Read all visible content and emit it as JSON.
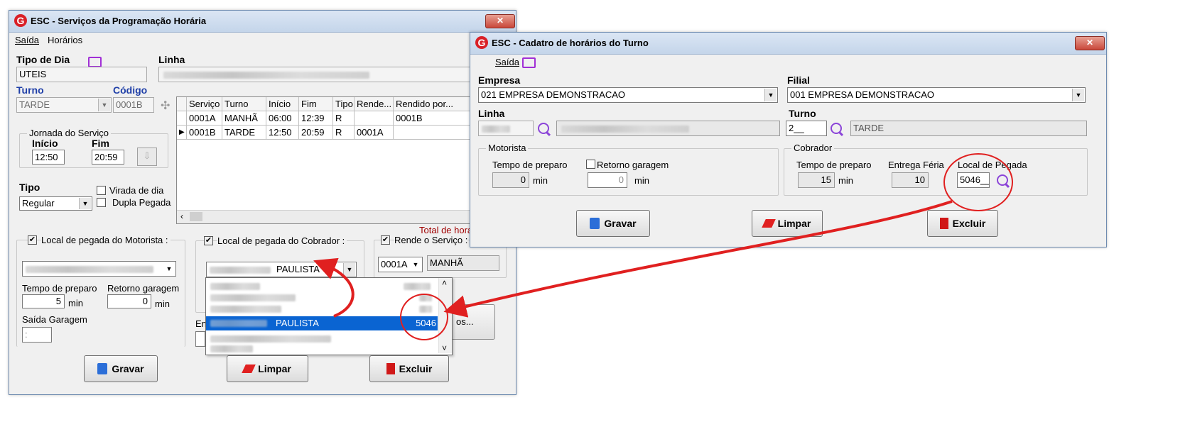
{
  "win1": {
    "title": "ESC - Serviços da Programação Horária",
    "menu": [
      "Saída",
      "Horários"
    ],
    "tipo_de_dia": {
      "label": "Tipo de Dia",
      "value": "UTEIS"
    },
    "linha": {
      "label": "Linha"
    },
    "turno": {
      "label": "Turno",
      "value": "TARDE"
    },
    "codigo": {
      "label": "Código",
      "value": "0001B"
    },
    "jornada": {
      "label": "Jornada do Serviço",
      "inicio_label": "Início",
      "inicio": "12:50",
      "fim_label": "Fim",
      "fim": "20:59"
    },
    "tipo": {
      "label": "Tipo",
      "value": "Regular"
    },
    "virada": "Virada de dia",
    "dupla": "Dupla Pegada",
    "grid": {
      "columns": [
        "Serviço",
        "Turno",
        "Início",
        "Fim",
        "Tipo",
        "Rende...",
        "Rendido por..."
      ],
      "rows": [
        [
          "0001A",
          "MANHÃ",
          "06:00",
          "12:39",
          "R",
          "",
          "0001B"
        ],
        [
          "0001B",
          "TARDE",
          "12:50",
          "20:59",
          "R",
          "0001A",
          ""
        ]
      ]
    },
    "total_label": "Total de hora",
    "motorista_group": "Local de pegada do Motorista :",
    "tempo_preparo_label": "Tempo de preparo",
    "tempo_preparo": "5",
    "retorno_label": "Retorno garagem",
    "retorno": "0",
    "min": "min",
    "saida_garagem_label": "Saída Garagem",
    "saida_garagem": ":",
    "cobrador_group": "Local de pegada do Cobrador :",
    "cobrador_value": "PAULISTA",
    "dropdown_selected": {
      "name": "PAULISTA",
      "code": "5046"
    },
    "rende_group": "Rende o Serviço :",
    "rende_code": "0001A",
    "rende_turno": "MANHÃ",
    "en_label": "En",
    "partial_button": "os...",
    "buttons": {
      "gravar": "Gravar",
      "limpar": "Limpar",
      "excluir": "Excluir"
    }
  },
  "win2": {
    "title": "ESC - Cadatro de horários do Turno",
    "menu": [
      "Saída"
    ],
    "empresa": {
      "label": "Empresa",
      "value": "021 EMPRESA DEMONSTRACAO"
    },
    "filial": {
      "label": "Filial",
      "value": "001 EMPRESA DEMONSTRACAO"
    },
    "linha": {
      "label": "Linha"
    },
    "turno": {
      "label": "Turno",
      "code": "2__",
      "value": "TARDE"
    },
    "motorista": {
      "group": "Motorista",
      "tempo_label": "Tempo de preparo",
      "tempo": "0",
      "retorno_label": "Retorno garagem",
      "retorno": "0"
    },
    "cobrador": {
      "group": "Cobrador",
      "tempo_label": "Tempo de preparo",
      "tempo": "15",
      "entrega_label": "Entrega Féria",
      "entrega": "10",
      "local_label": "Local de Pegada",
      "local": "5046__"
    },
    "min": "min",
    "buttons": {
      "gravar": "Gravar",
      "limpar": "Limpar",
      "excluir": "Excluir"
    }
  },
  "colors": {
    "accent_red": "#e02020",
    "selection_blue": "#0a64d2",
    "magnifier": "#8b44d8"
  }
}
